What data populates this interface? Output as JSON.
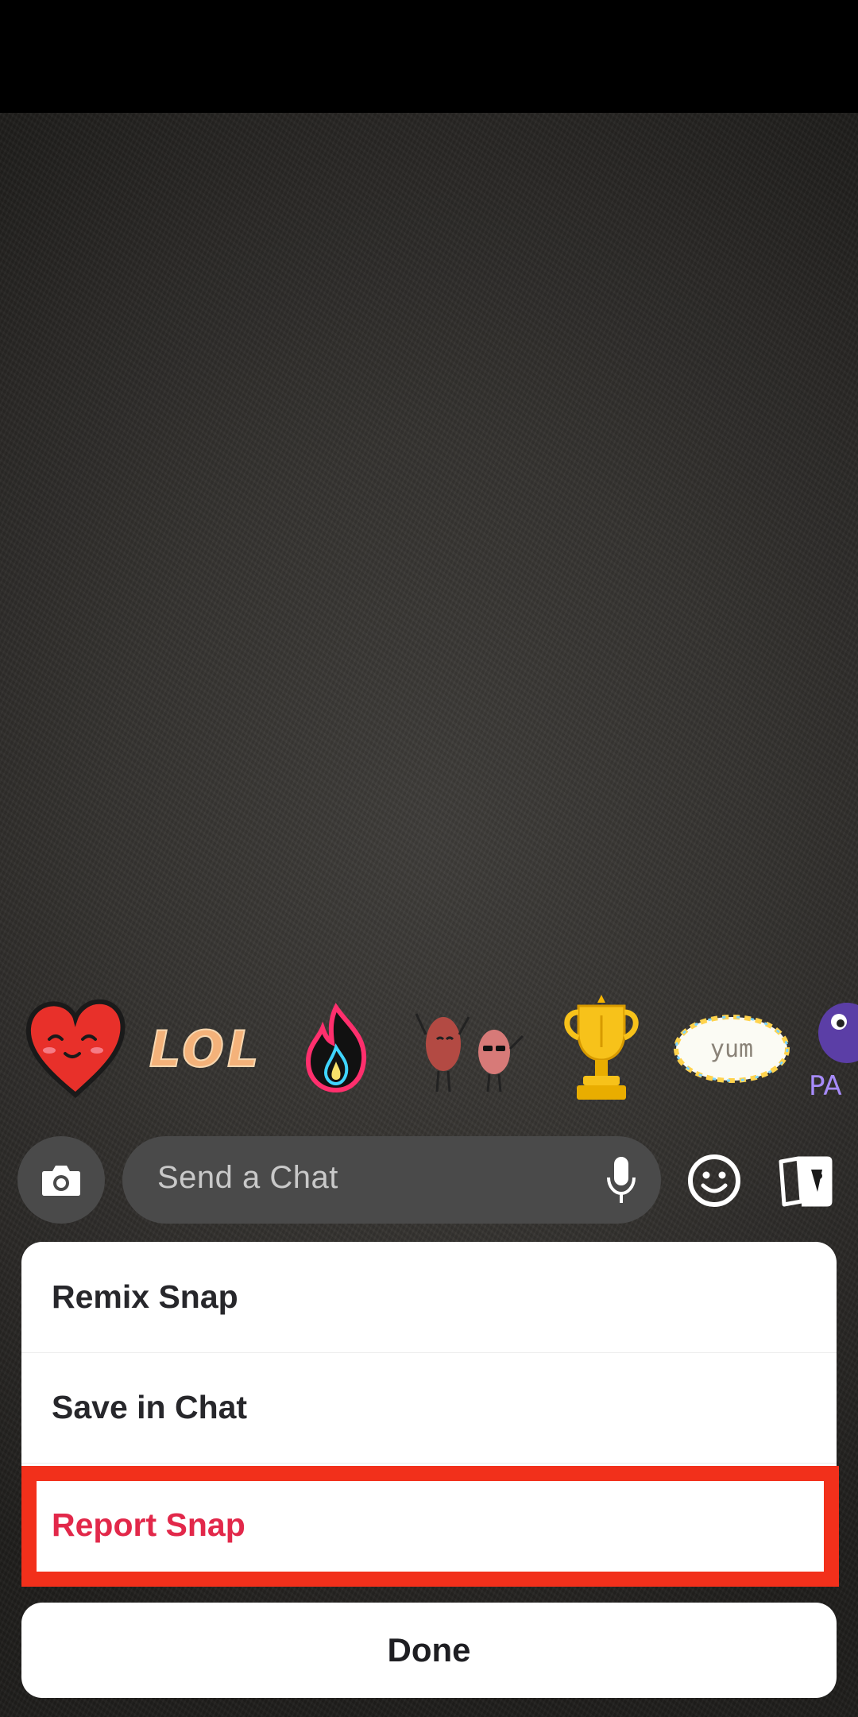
{
  "stickers": [
    {
      "name": "heart-sticker"
    },
    {
      "name": "lol-sticker",
      "text": "LOL"
    },
    {
      "name": "fire-sticker"
    },
    {
      "name": "beans-sticker"
    },
    {
      "name": "trophy-sticker"
    },
    {
      "name": "yum-sticker",
      "text": "yum"
    },
    {
      "name": "party-sticker",
      "text": "PA"
    }
  ],
  "chat_bar": {
    "placeholder": "Send a Chat",
    "camera_icon": "camera-icon",
    "mic_icon": "microphone-icon",
    "emoji_icon": "smiley-icon",
    "cards_icon": "cards-icon"
  },
  "action_sheet": {
    "items": [
      {
        "label": "Remix Snap"
      },
      {
        "label": "Save in Chat"
      },
      {
        "label": "Report Snap",
        "color": "#e2284a"
      }
    ],
    "done_label": "Done"
  },
  "colors": {
    "highlight": "#f2301b",
    "danger": "#e2284a"
  }
}
